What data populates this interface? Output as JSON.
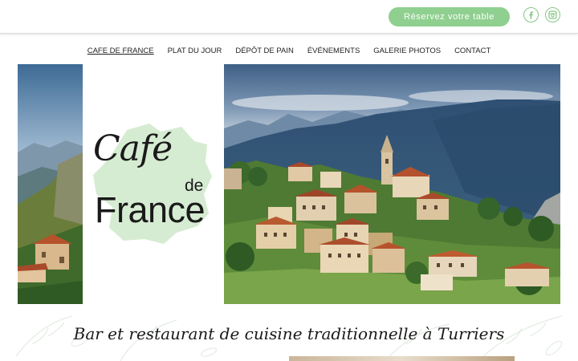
{
  "header": {
    "reserve_label": "Réservez votre table",
    "social_icons": [
      "facebook-icon",
      "instagram-icon"
    ],
    "accent_color": "#8fcf8f"
  },
  "nav": {
    "items": [
      {
        "label": "CAFE DE FRANCE",
        "active": true
      },
      {
        "label": "PLAT DU JOUR",
        "active": false
      },
      {
        "label": "DÉPÔT DE PAIN",
        "active": false
      },
      {
        "label": "ÉVÉNEMENTS",
        "active": false
      },
      {
        "label": "GALERIE PHOTOS",
        "active": false
      },
      {
        "label": "CONTACT",
        "active": false
      }
    ]
  },
  "hero": {
    "logo": {
      "line1": "Café",
      "line2": "de",
      "line3": "France"
    }
  },
  "tagline": "Bar et restaurant de cuisine traditionnelle à Turriers"
}
